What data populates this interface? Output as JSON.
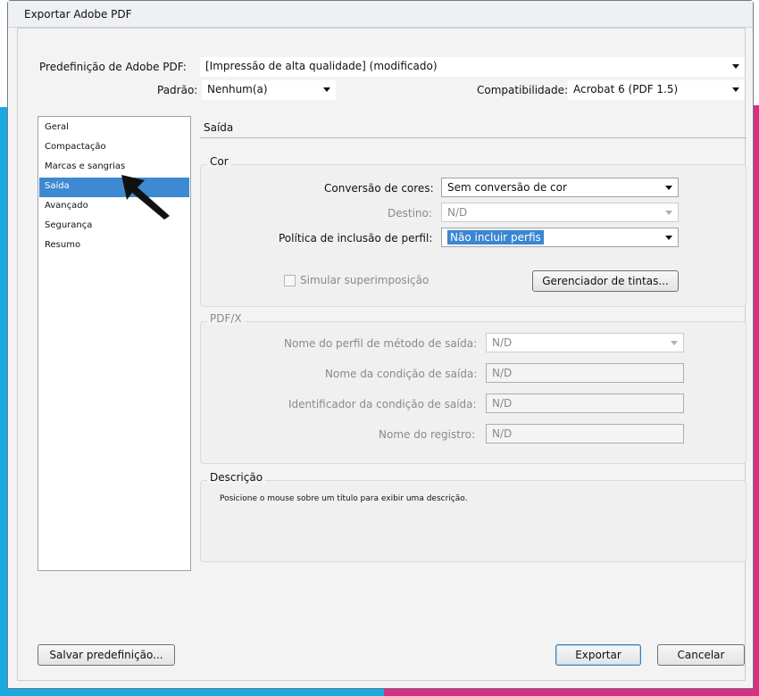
{
  "window": {
    "title": "Exportar Adobe PDF"
  },
  "preset": {
    "label": "Predefinição de Adobe PDF:",
    "value": "[Impressão de alta qualidade] (modificado)"
  },
  "standard": {
    "label": "Padrão:",
    "value": "Nenhum(a)"
  },
  "compatibility": {
    "label": "Compatibilidade:",
    "value": "Acrobat 6 (PDF 1.5)"
  },
  "sidebar": {
    "items": [
      {
        "label": "Geral"
      },
      {
        "label": "Compactação"
      },
      {
        "label": "Marcas e sangrias"
      },
      {
        "label": "Saída",
        "selected": true
      },
      {
        "label": "Avançado"
      },
      {
        "label": "Segurança"
      },
      {
        "label": "Resumo"
      }
    ]
  },
  "panel": {
    "title": "Saída"
  },
  "color_group": {
    "title": "Cor",
    "conversion_label": "Conversão de cores:",
    "conversion_value": "Sem conversão de cor",
    "destination_label": "Destino:",
    "destination_value": "N/D",
    "profile_policy_label": "Política de inclusão de perfil:",
    "profile_policy_value": "Não incluir perfis",
    "simulate_overprint_label": "Simular superimposição",
    "ink_manager_label": "Gerenciador de tintas..."
  },
  "pdfx_group": {
    "title": "PDF/X",
    "output_profile_label": "Nome do perfil de método de saída:",
    "output_profile_value": "N/D",
    "condition_name_label": "Nome da condição de saída:",
    "condition_name_value": "N/D",
    "condition_id_label": "Identificador da condição de saída:",
    "condition_id_value": "N/D",
    "registry_label": "Nome do registro:",
    "registry_value": "N/D"
  },
  "description_group": {
    "title": "Descrição",
    "text": "Posicione o mouse sobre um título para exibir uma descrição."
  },
  "buttons": {
    "save_preset": "Salvar predefinição...",
    "export": "Exportar",
    "cancel": "Cancelar"
  },
  "colors": {
    "selection": "#3d8ad3",
    "accent_cyan": "#1aa8e0",
    "accent_magenta": "#d6307f"
  }
}
